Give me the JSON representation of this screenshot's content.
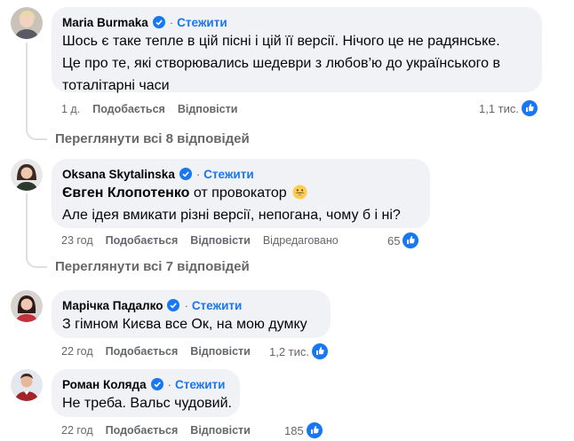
{
  "comments": [
    {
      "author": "Maria Burmaka",
      "follow": "Стежити",
      "lines": [
        "Шось є таке тепле в цій пісні і цій її версії. Нічого це не радянське.",
        "Це про те, які створювались шедеври з любов’ю до українського в",
        "тоталітарні часи"
      ],
      "time": "1 д.",
      "like": "Подобається",
      "reply": "Відповісти",
      "reactions": "1,1 тис."
    },
    {
      "author": "Oksana Skytalinska",
      "follow": "Стежити",
      "mention": "Євген Клопотенко",
      "line1_rest": " от провокатор",
      "line2": "Але ідея вмикати різні версії, непогана, чому б і ні?",
      "time": "23 год",
      "like": "Подобається",
      "reply": "Відповісти",
      "edited": "Відредаговано",
      "reactions": "65"
    },
    {
      "author": "Марічка Падалко",
      "follow": "Стежити",
      "text": "З гімном Києва все Ок, на мою думку",
      "time": "22 год",
      "like": "Подобається",
      "reply": "Відповісти",
      "reactions": "1,2 тис."
    },
    {
      "author": "Роман Коляда",
      "follow": "Стежити",
      "text": "Не треба. Вальс чудовий.",
      "time": "22 год",
      "like": "Подобається",
      "reply": "Відповісти",
      "reactions": "185"
    }
  ],
  "view_replies": [
    "Переглянути всі 8 відповідей",
    "Переглянути всі 7 відповідей"
  ],
  "icons": {
    "verified": "verified-badge-icon",
    "like": "like-thumb-icon",
    "emoji": "grinning-face-emoji"
  },
  "colors": {
    "accent": "#1877f2",
    "secondary_text": "#65676b",
    "bubble": "#f0f2f5"
  }
}
